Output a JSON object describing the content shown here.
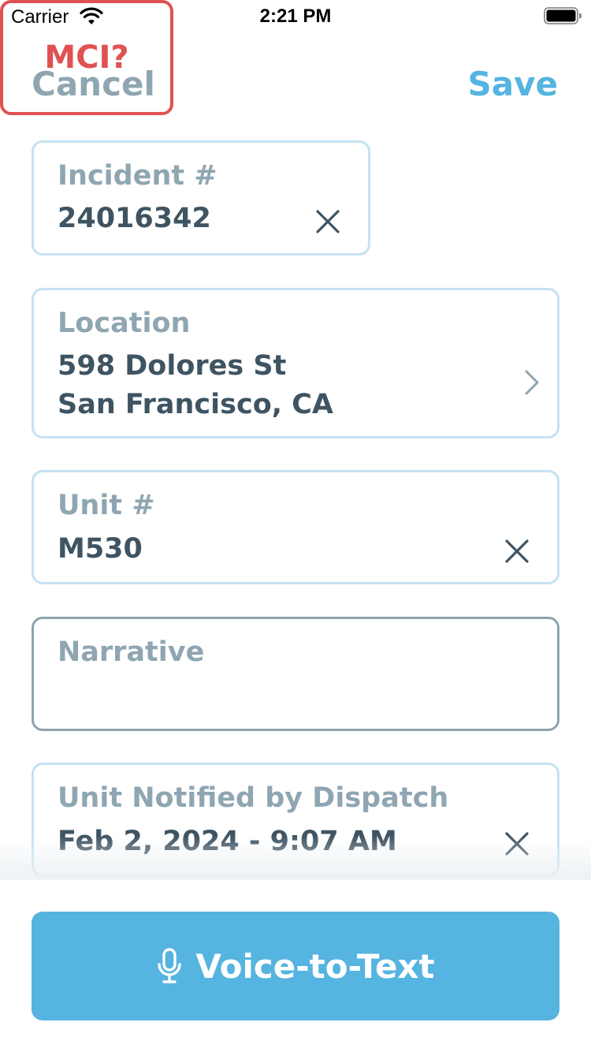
{
  "status_bar": {
    "carrier": "Carrier",
    "time": "2:21 PM"
  },
  "nav": {
    "cancel_label": "Cancel",
    "save_label": "Save"
  },
  "incident": {
    "label": "Incident #",
    "value": "24016342"
  },
  "mci": {
    "label": "MCI?"
  },
  "location": {
    "label": "Location",
    "line1": "598 Dolores St",
    "line2": "San Francisco, CA"
  },
  "unit": {
    "label": "Unit #",
    "value": "M530"
  },
  "narrative": {
    "label": "Narrative",
    "value": ""
  },
  "dispatch": {
    "label": "Unit Notified by Dispatch",
    "value": "Feb 2, 2024 - 9:07 AM"
  },
  "voice_button": {
    "label": "Voice-to-Text"
  },
  "colors": {
    "accent": "#55b4e0",
    "danger": "#e05252",
    "muted": "#8fa6b2",
    "text": "#3f5462",
    "field_border": "#c4e2f1"
  },
  "icons": [
    "wifi-icon",
    "battery-icon",
    "clear-icon",
    "chevron-right-icon",
    "microphone-icon"
  ]
}
